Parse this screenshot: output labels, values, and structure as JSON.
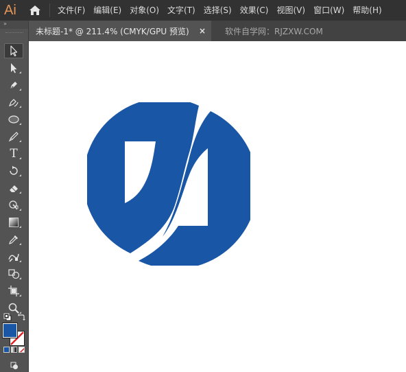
{
  "app": {
    "logo_text": "Ai",
    "logo_color": "#e4965a"
  },
  "menu": {
    "items": [
      {
        "label": "文件(F)"
      },
      {
        "label": "编辑(E)"
      },
      {
        "label": "对象(O)"
      },
      {
        "label": "文字(T)"
      },
      {
        "label": "选择(S)"
      },
      {
        "label": "效果(C)"
      },
      {
        "label": "视图(V)"
      },
      {
        "label": "窗口(W)"
      },
      {
        "label": "帮助(H)"
      }
    ]
  },
  "tabs": {
    "active_label": "未标题-1* @ 211.4% (CMYK/GPU 预览)",
    "close_glyph": "×",
    "inactive_label": "软件自学网：RJZXW.COM"
  },
  "toolbar": {
    "collapse_glyph": "»",
    "tools": [
      {
        "icon": "selection-arrow-icon"
      },
      {
        "icon": "direct-selection-arrow-icon"
      },
      {
        "icon": "pen-icon"
      },
      {
        "icon": "curvature-icon"
      },
      {
        "icon": "ellipse-icon"
      },
      {
        "icon": "paintbrush-icon"
      },
      {
        "icon": "type-icon",
        "glyph": "T"
      },
      {
        "icon": "rotate-icon"
      },
      {
        "icon": "eraser-icon"
      },
      {
        "icon": "warp-icon"
      },
      {
        "icon": "gradient-icon"
      },
      {
        "icon": "eyedropper-icon"
      },
      {
        "icon": "blend-icon"
      },
      {
        "icon": "shape-builder-icon"
      },
      {
        "icon": "artboard-icon"
      },
      {
        "icon": "zoom-icon"
      }
    ],
    "fill_color": "#1a56a6",
    "stroke": "none"
  },
  "artwork": {
    "fill_color": "#1a56a6"
  }
}
